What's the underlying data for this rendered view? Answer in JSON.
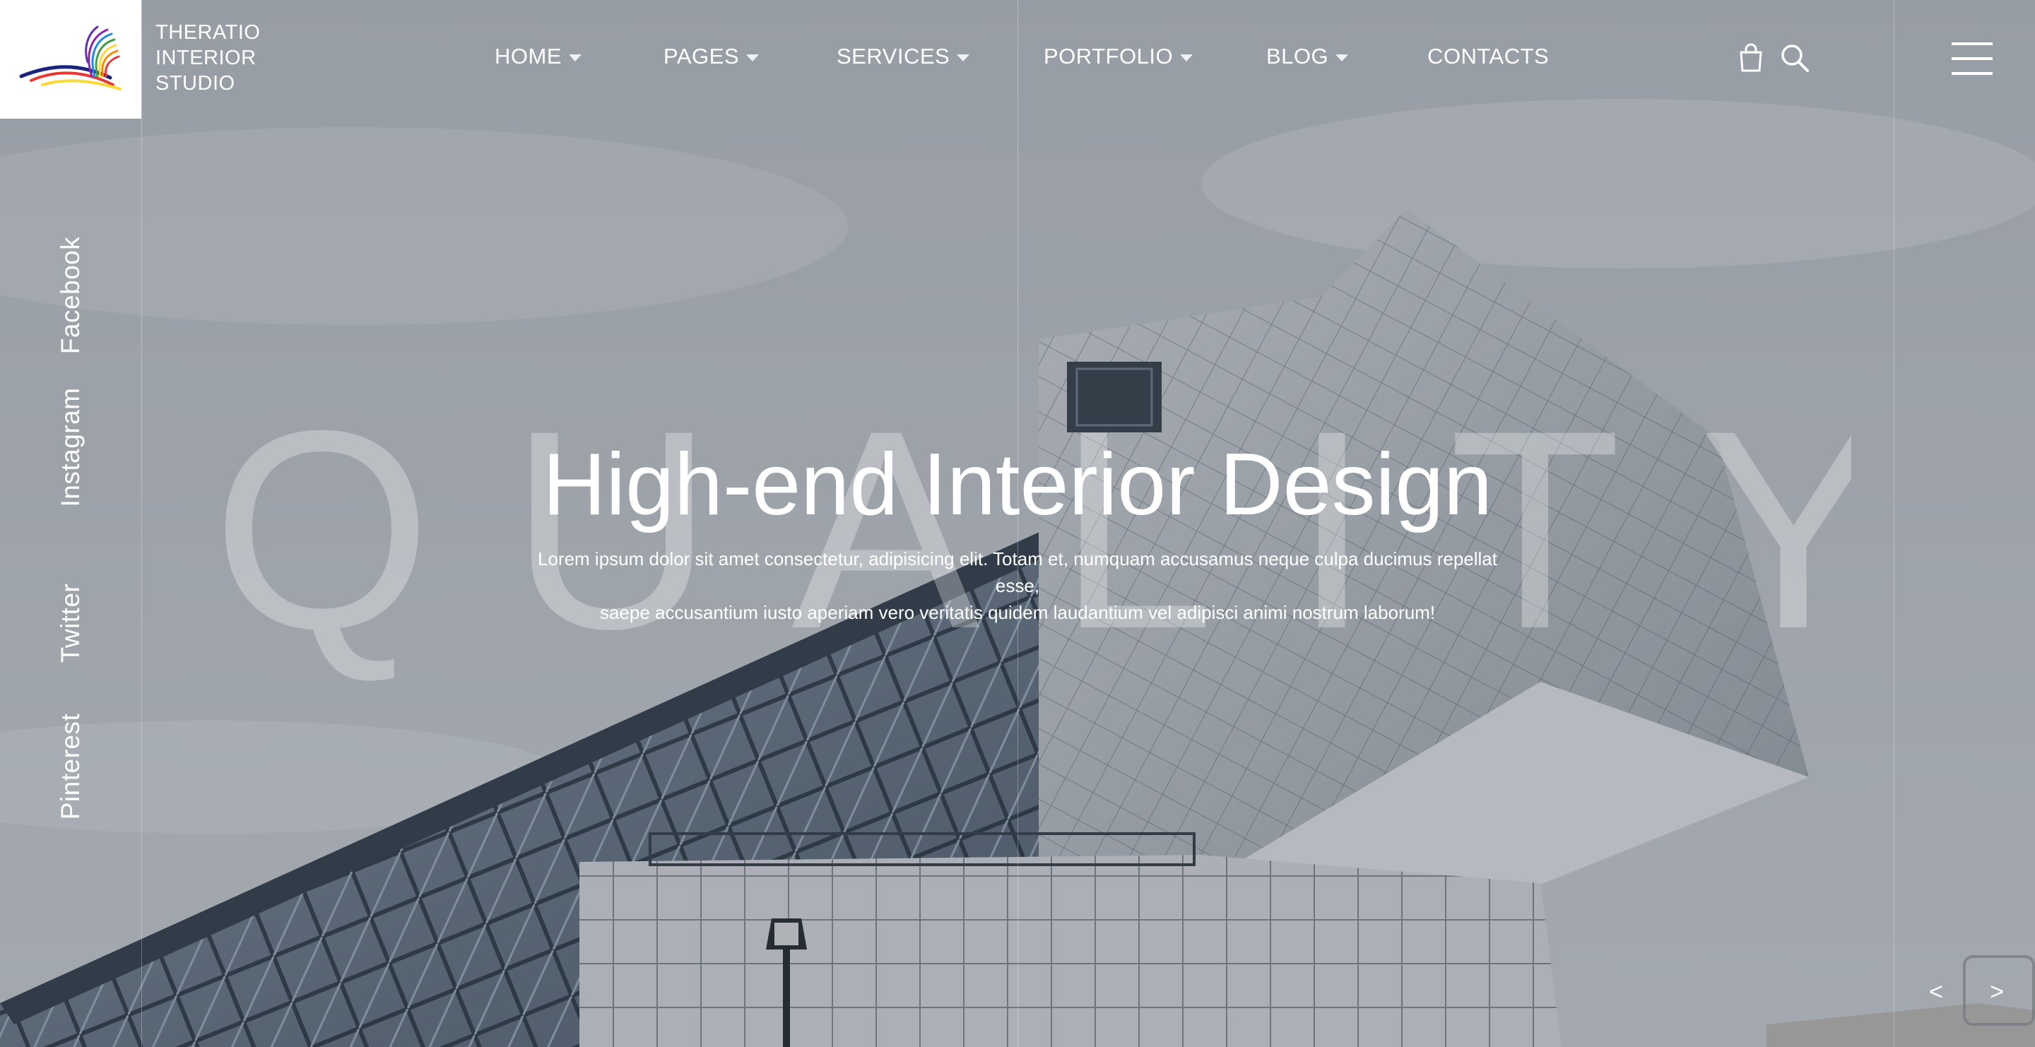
{
  "brand": {
    "name_lines": [
      "THERATIO",
      "INTERIOR",
      "STUDIO"
    ],
    "logo_icon": "rainbow-swirl-logo",
    "logo_colors": [
      "#e53935",
      "#fb8c00",
      "#fdd835",
      "#43a047",
      "#1e88e5",
      "#8e24aa",
      "#1a237e"
    ]
  },
  "nav": {
    "items": [
      {
        "label": "HOME",
        "has_dropdown": true
      },
      {
        "label": "PAGES",
        "has_dropdown": true
      },
      {
        "label": "SERVICES",
        "has_dropdown": true
      },
      {
        "label": "PORTFOLIO",
        "has_dropdown": true
      },
      {
        "label": "BLOG",
        "has_dropdown": true
      },
      {
        "label": "CONTACTS",
        "has_dropdown": false
      }
    ],
    "tools": [
      {
        "icon": "shopping-bag-icon"
      },
      {
        "icon": "search-icon"
      }
    ],
    "menu_icon": "hamburger-menu-icon"
  },
  "social": {
    "links": [
      "Facebook",
      "Instagram",
      "Twitter",
      "Pinterest"
    ]
  },
  "hero": {
    "background_word": "QUALITY",
    "headline": "High-end Interior Design",
    "subtext_line1": "Lorem ipsum dolor sit amet consectetur, adipisicing elit. Totam et, numquam accusamus neque culpa ducimus repellat esse,",
    "subtext_line2": "saepe accusantium iusto aperiam vero veritatis quidem laudantium vel adipisci animi nostrum laborum!",
    "background_image": "modern glass building under cloudy sky"
  },
  "slider": {
    "prev_label": "<",
    "next_label": ">"
  },
  "colors": {
    "overlay": "#5a6470",
    "text": "#ffffff",
    "logo_background": "#ffffff"
  }
}
